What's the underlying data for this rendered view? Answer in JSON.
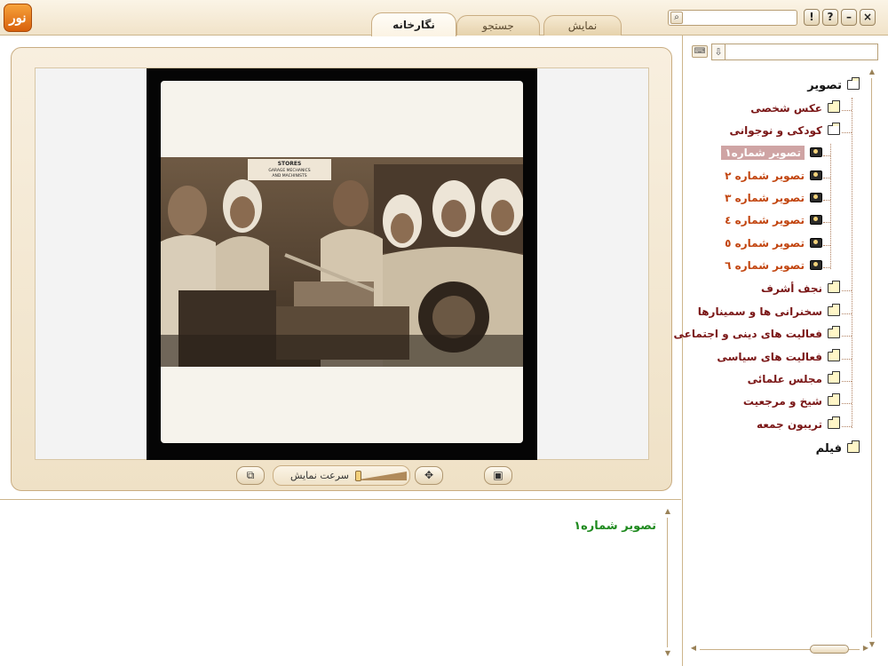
{
  "app": {
    "logo_text": "نور"
  },
  "tabs": [
    {
      "label": "نمایش",
      "active": false
    },
    {
      "label": "جستجو",
      "active": false
    },
    {
      "label": "نگارخانه",
      "active": true
    }
  ],
  "window_buttons": [
    "!",
    "?",
    "–",
    "×"
  ],
  "viewer": {
    "speed_label": "سرعت نمایش",
    "photo_sign_lines": [
      "STORES",
      "GARAGE MECHANICS",
      "AND MACHINISTS"
    ]
  },
  "caption": {
    "text": "تصویر شماره١"
  },
  "tree": {
    "root": "تصویر",
    "folders": [
      {
        "label": "عکس شخصی"
      },
      {
        "label": "کودکی و نوجوانی",
        "open": true,
        "children": [
          {
            "label": "تصویر شماره١",
            "selected": true
          },
          {
            "label": "تصویر شماره ٢"
          },
          {
            "label": "تصویر شماره ٣"
          },
          {
            "label": "تصویر شماره ٤"
          },
          {
            "label": "تصویر شماره ٥"
          },
          {
            "label": "تصویر شماره ٦"
          }
        ]
      },
      {
        "label": "نجف أشرف"
      },
      {
        "label": "سخنرانی ها و سمینارها"
      },
      {
        "label": "فعالیت های دینی و اجتماعی"
      },
      {
        "label": "فعالیت های سیاسی"
      },
      {
        "label": "مجلس علمائی"
      },
      {
        "label": "شیخ و مرجعیت"
      },
      {
        "label": "تریبون جمعه"
      }
    ],
    "film": "فیلم"
  },
  "colors": {
    "accent": "#c2450f",
    "folder_text": "#7a1616",
    "caption_green": "#1f8a1f",
    "selection": "#cfa4a4"
  }
}
